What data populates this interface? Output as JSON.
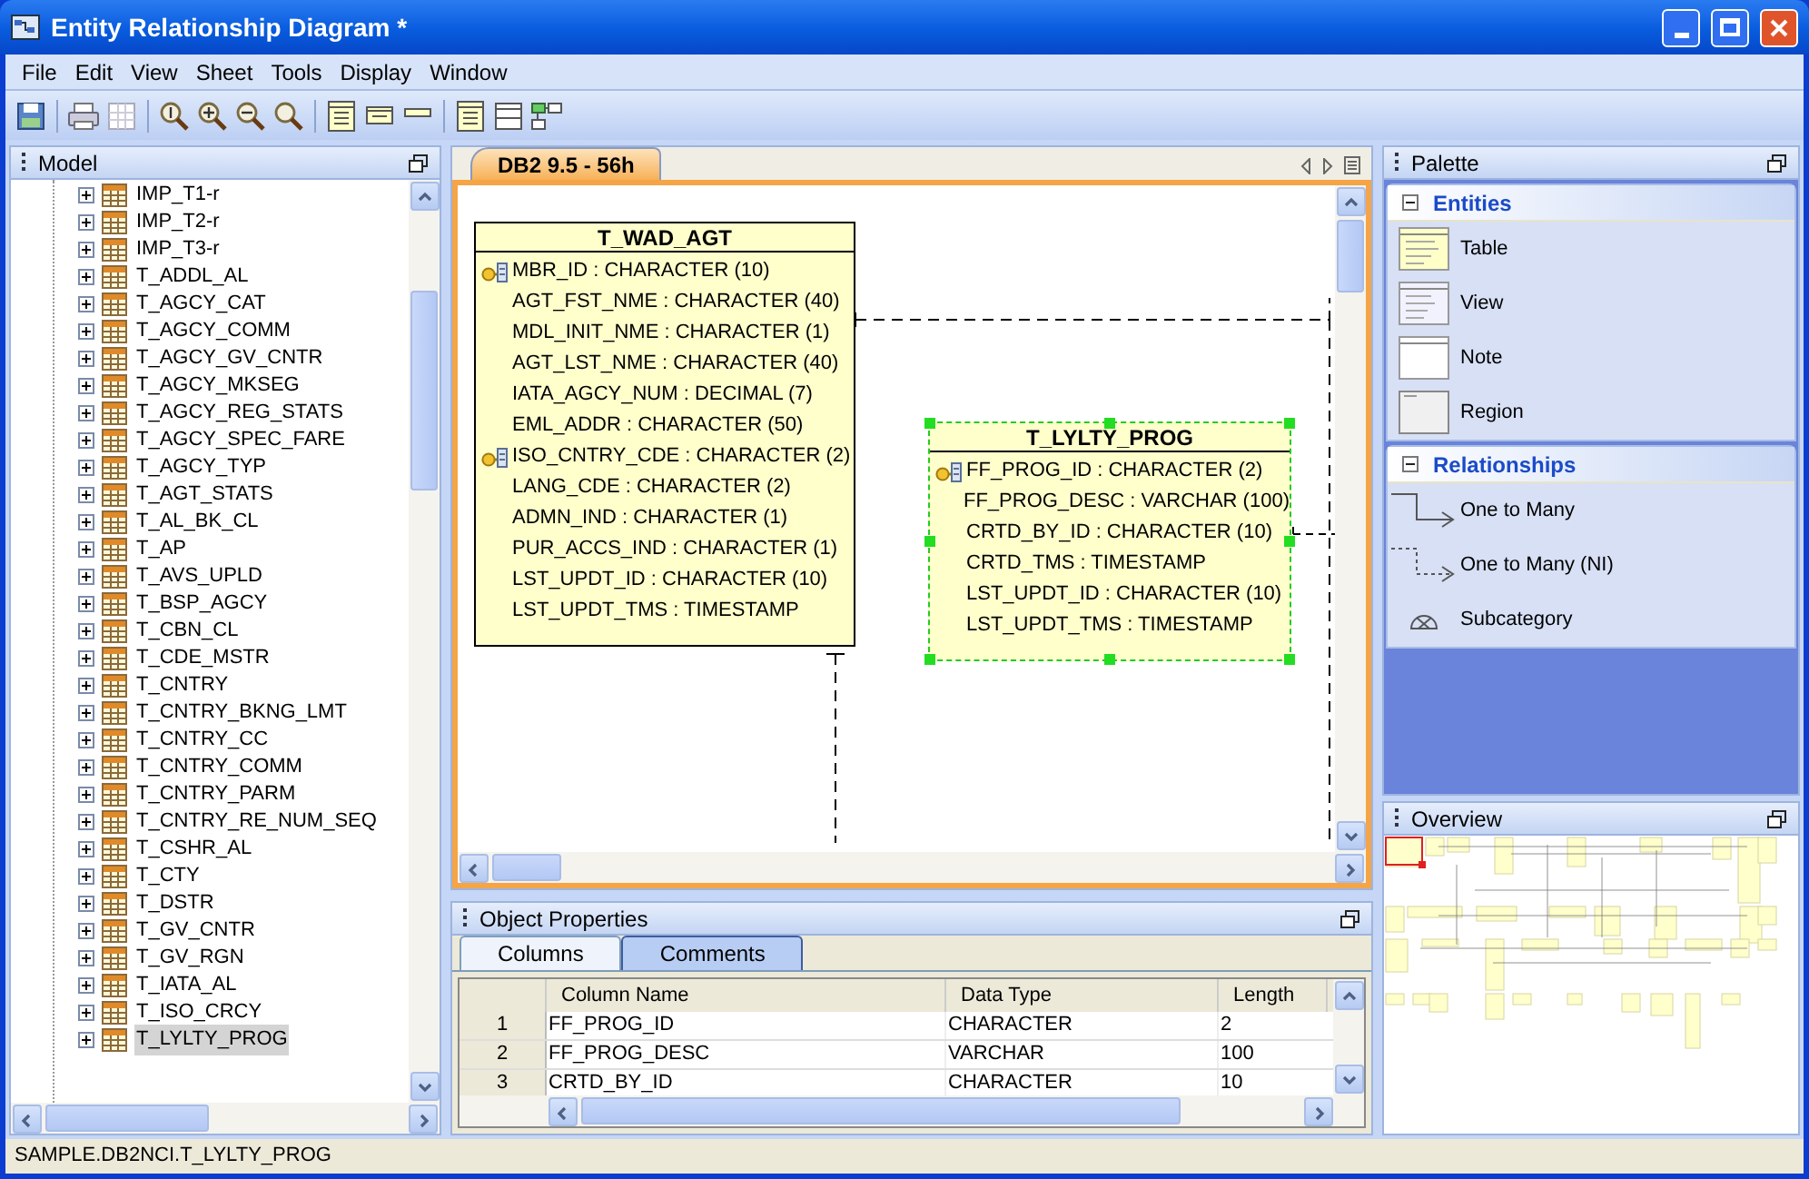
{
  "window": {
    "title": "Entity Relationship Diagram *"
  },
  "menu": [
    "File",
    "Edit",
    "View",
    "Sheet",
    "Tools",
    "Display",
    "Window"
  ],
  "model_panel": {
    "title": "Model",
    "items": [
      {
        "label": "IMP_T1-r",
        "selected": false
      },
      {
        "label": "IMP_T2-r",
        "selected": false
      },
      {
        "label": "IMP_T3-r",
        "selected": false
      },
      {
        "label": "T_ADDL_AL",
        "selected": false
      },
      {
        "label": "T_AGCY_CAT",
        "selected": false
      },
      {
        "label": "T_AGCY_COMM",
        "selected": false
      },
      {
        "label": "T_AGCY_GV_CNTR",
        "selected": false
      },
      {
        "label": "T_AGCY_MKSEG",
        "selected": false
      },
      {
        "label": "T_AGCY_REG_STATS",
        "selected": false
      },
      {
        "label": "T_AGCY_SPEC_FARE",
        "selected": false
      },
      {
        "label": "T_AGCY_TYP",
        "selected": false
      },
      {
        "label": "T_AGT_STATS",
        "selected": false
      },
      {
        "label": "T_AL_BK_CL",
        "selected": false
      },
      {
        "label": "T_AP",
        "selected": false
      },
      {
        "label": "T_AVS_UPLD",
        "selected": false
      },
      {
        "label": "T_BSP_AGCY",
        "selected": false
      },
      {
        "label": "T_CBN_CL",
        "selected": false
      },
      {
        "label": "T_CDE_MSTR",
        "selected": false
      },
      {
        "label": "T_CNTRY",
        "selected": false
      },
      {
        "label": "T_CNTRY_BKNG_LMT",
        "selected": false
      },
      {
        "label": "T_CNTRY_CC",
        "selected": false
      },
      {
        "label": "T_CNTRY_COMM",
        "selected": false
      },
      {
        "label": "T_CNTRY_PARM",
        "selected": false
      },
      {
        "label": "T_CNTRY_RE_NUM_SEQ",
        "selected": false
      },
      {
        "label": "T_CSHR_AL",
        "selected": false
      },
      {
        "label": "T_CTY",
        "selected": false
      },
      {
        "label": "T_DSTR",
        "selected": false
      },
      {
        "label": "T_GV_CNTR",
        "selected": false
      },
      {
        "label": "T_GV_RGN",
        "selected": false
      },
      {
        "label": "T_IATA_AL",
        "selected": false
      },
      {
        "label": "T_ISO_CRCY",
        "selected": false
      },
      {
        "label": "T_LYLTY_PROG",
        "selected": true
      }
    ]
  },
  "diagram": {
    "tab": "DB2 9.5 - 56h",
    "entities": [
      {
        "name": "T_WAD_AGT",
        "selected": false,
        "attributes": [
          {
            "text": "MBR_ID : CHARACTER (10)",
            "key": true
          },
          {
            "text": "AGT_FST_NME : CHARACTER (40)",
            "key": false
          },
          {
            "text": "MDL_INIT_NME : CHARACTER (1)",
            "key": false
          },
          {
            "text": "AGT_LST_NME : CHARACTER (40)",
            "key": false
          },
          {
            "text": "IATA_AGCY_NUM : DECIMAL (7)",
            "key": false
          },
          {
            "text": "EML_ADDR : CHARACTER (50)",
            "key": false
          },
          {
            "text": "ISO_CNTRY_CDE : CHARACTER (2)",
            "key": true
          },
          {
            "text": "LANG_CDE : CHARACTER (2)",
            "key": false
          },
          {
            "text": "ADMN_IND : CHARACTER (1)",
            "key": false
          },
          {
            "text": "PUR_ACCS_IND : CHARACTER (1)",
            "key": false
          },
          {
            "text": "LST_UPDT_ID : CHARACTER (10)",
            "key": false
          },
          {
            "text": "LST_UPDT_TMS : TIMESTAMP",
            "key": false
          }
        ]
      },
      {
        "name": "T_LYLTY_PROG",
        "selected": true,
        "attributes": [
          {
            "text": "FF_PROG_ID : CHARACTER (2)",
            "key": true
          },
          {
            "text": "FF_PROG_DESC : VARCHAR (100)",
            "key": false
          },
          {
            "text": "CRTD_BY_ID : CHARACTER (10)",
            "key": false
          },
          {
            "text": "CRTD_TMS : TIMESTAMP",
            "key": false
          },
          {
            "text": "LST_UPDT_ID : CHARACTER (10)",
            "key": false
          },
          {
            "text": "LST_UPDT_TMS : TIMESTAMP",
            "key": false
          }
        ]
      }
    ]
  },
  "object_properties": {
    "title": "Object Properties",
    "tabs": [
      {
        "label": "Columns",
        "selected": true
      },
      {
        "label": "Comments",
        "selected": false
      }
    ],
    "columns": [
      "",
      "Column Name",
      "Data Type",
      "Length"
    ],
    "rows": [
      [
        "1",
        "FF_PROG_ID",
        "CHARACTER",
        "2"
      ],
      [
        "2",
        "FF_PROG_DESC",
        "VARCHAR",
        "100"
      ],
      [
        "3",
        "CRTD_BY_ID",
        "CHARACTER",
        "10"
      ]
    ]
  },
  "palette": {
    "title": "Palette",
    "sections": [
      {
        "title": "Entities",
        "expanded": true,
        "items": [
          {
            "label": "Table",
            "kind": "table"
          },
          {
            "label": "View",
            "kind": "view"
          },
          {
            "label": "Note",
            "kind": "note"
          },
          {
            "label": "Region",
            "kind": "region"
          }
        ]
      },
      {
        "title": "Relationships",
        "expanded": true,
        "items": [
          {
            "label": "One to Many",
            "kind": "solid"
          },
          {
            "label": "One to Many (NI)",
            "kind": "dashed"
          },
          {
            "label": "Subcategory",
            "kind": "subcategory"
          }
        ]
      }
    ]
  },
  "overview": {
    "title": "Overview"
  },
  "status_bar": "SAMPLE.DB2NCI.T_LYLTY_PROG"
}
